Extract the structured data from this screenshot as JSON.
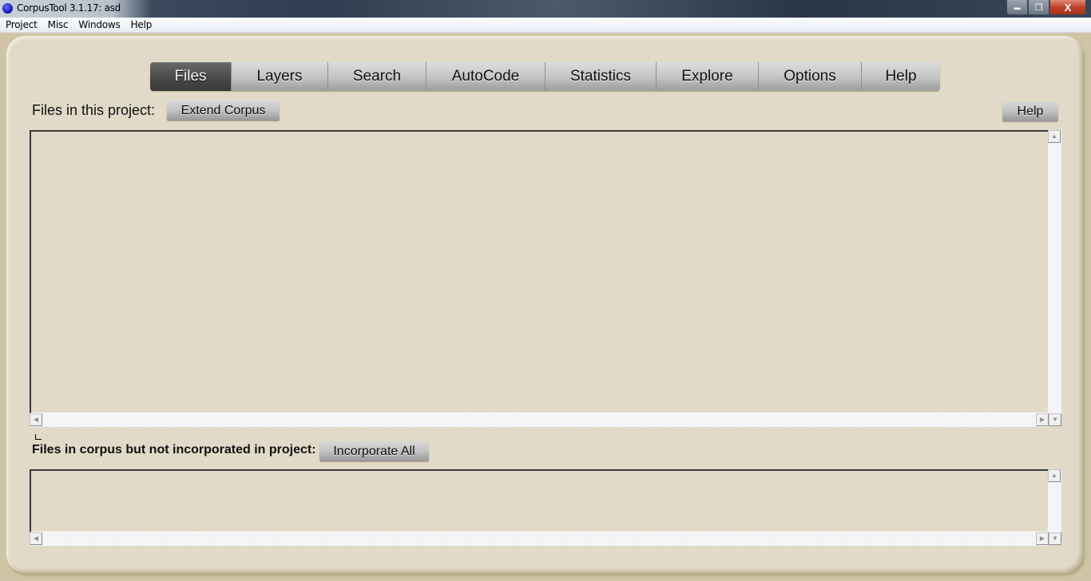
{
  "window": {
    "title": "CorpusTool 3.1.17: asd",
    "controls": {
      "minimize_icon": "minimize-icon",
      "maximize_icon": "restore-icon",
      "close_icon": "close-icon",
      "minimize_glyph": "▬",
      "restore_glyph": "❐",
      "close_glyph": "X"
    }
  },
  "menubar": {
    "items": [
      {
        "label": "Project"
      },
      {
        "label": "Misc"
      },
      {
        "label": "Windows"
      },
      {
        "label": "Help"
      }
    ]
  },
  "tabs": {
    "active": "Files",
    "items": [
      {
        "label": "Files"
      },
      {
        "label": "Layers"
      },
      {
        "label": "Search"
      },
      {
        "label": "AutoCode"
      },
      {
        "label": "Statistics"
      },
      {
        "label": "Explore"
      },
      {
        "label": "Options"
      },
      {
        "label": "Help"
      }
    ]
  },
  "files_page": {
    "project_files_label": "Files in this project:",
    "extend_corpus_button": "Extend Corpus",
    "help_button": "Help",
    "project_files": [],
    "unincorporated_label": "Files in corpus but not incorporated in project:",
    "incorporate_all_button": "Incorporate All",
    "unincorporated_files": []
  },
  "scroll_glyphs": {
    "up": "▲",
    "down": "▼",
    "left": "◀",
    "right": "▶"
  },
  "colors": {
    "panel_background": "#e1dac8",
    "active_tab": "#474747",
    "inactive_tab": "#c6c6c6"
  }
}
